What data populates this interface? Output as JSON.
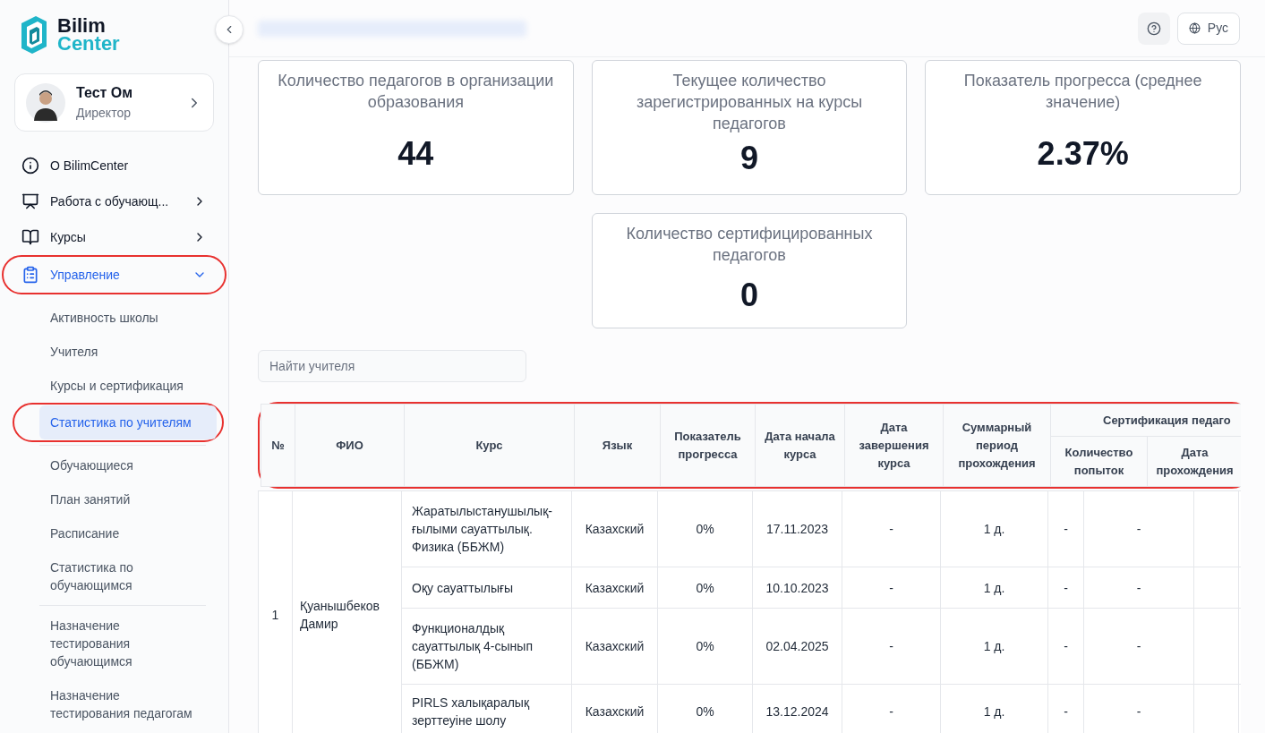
{
  "sidebar": {
    "logo": {
      "line1": "Bilim",
      "line2": "Center"
    },
    "profile": {
      "name": "Тест Ом",
      "role": "Директор"
    },
    "nav": [
      {
        "label": "О BilimCenter",
        "has_children": false,
        "selected": false,
        "highlighted": false
      },
      {
        "label": "Работа с обучающ...",
        "has_children": true,
        "expanded": false,
        "selected": false,
        "highlighted": false
      },
      {
        "label": "Курсы",
        "has_children": true,
        "expanded": false,
        "selected": false,
        "highlighted": false
      },
      {
        "label": "Управление",
        "has_children": true,
        "expanded": true,
        "selected": true,
        "highlighted": true,
        "groups": [
          {
            "items": [
              {
                "label": "Активность школы",
                "selected": false,
                "highlighted": false
              },
              {
                "label": "Учителя",
                "selected": false,
                "highlighted": false
              },
              {
                "label": "Курсы и сертификация",
                "selected": false,
                "highlighted": false
              },
              {
                "label": "Статистика по учителям",
                "selected": true,
                "highlighted": true
              }
            ]
          },
          {
            "items": [
              {
                "label": "Обучающиеся",
                "selected": false,
                "highlighted": false
              },
              {
                "label": "План занятий",
                "selected": false,
                "highlighted": false
              },
              {
                "label": "Расписание",
                "selected": false,
                "highlighted": false
              },
              {
                "label": "Статистика по обучающимся",
                "selected": false,
                "highlighted": false
              }
            ]
          },
          {
            "items": [
              {
                "label": "Назначение тестирования обучающимся",
                "selected": false,
                "highlighted": false
              },
              {
                "label": "Назначение тестирования педагогам",
                "selected": false,
                "highlighted": false
              }
            ]
          }
        ]
      }
    ]
  },
  "topbar": {
    "language": "Рус"
  },
  "stats": [
    {
      "label": "Количество педагогов в организации образования",
      "value": "44"
    },
    {
      "label": "Текущее количество зарегистрированных на курсы педагогов",
      "value": "9"
    },
    {
      "label": "Показатель прогресса (среднее значение)",
      "value": "2.37%"
    },
    {
      "label": "Количество сертифицированных педагогов",
      "value": "0"
    }
  ],
  "search": {
    "placeholder": "Найти учителя"
  },
  "table": {
    "highlighted": true,
    "columns": [
      "№",
      "ФИО",
      "Курс",
      "Язык",
      "Показатель прогресса",
      "Дата начала курса",
      "Дата завершения курса",
      "Суммарный период прохождения"
    ],
    "group_column": {
      "label": "Сертификация педаго",
      "columns": [
        "Количество попыток",
        "Дата прохождения"
      ]
    },
    "rows": [
      {
        "number": "1",
        "name": "Қуанышбеков Дамир",
        "courses": [
          {
            "course": "Жаратылыстанушылық-ғылыми сауаттылық. Физика (ББЖМ)",
            "language": "Казахский",
            "progress": "0%",
            "start": "17.11.2023",
            "end": "-",
            "period": "1 д.",
            "attempts": "-",
            "cert_date": "-"
          },
          {
            "course": "Оқу сауаттылығы",
            "language": "Казахский",
            "progress": "0%",
            "start": "10.10.2023",
            "end": "-",
            "period": "1 д.",
            "attempts": "-",
            "cert_date": "-"
          },
          {
            "course": "Функционалдық сауаттылық 4-сынып (ББЖМ)",
            "language": "Казахский",
            "progress": "0%",
            "start": "02.04.2025",
            "end": "-",
            "period": "1 д.",
            "attempts": "-",
            "cert_date": "-"
          },
          {
            "course": "PIRLS халықаралық зерттеуіне шолу",
            "language": "Казахский",
            "progress": "0%",
            "start": "13.12.2024",
            "end": "-",
            "period": "1 д.",
            "attempts": "-",
            "cert_date": "-"
          }
        ]
      }
    ]
  }
}
